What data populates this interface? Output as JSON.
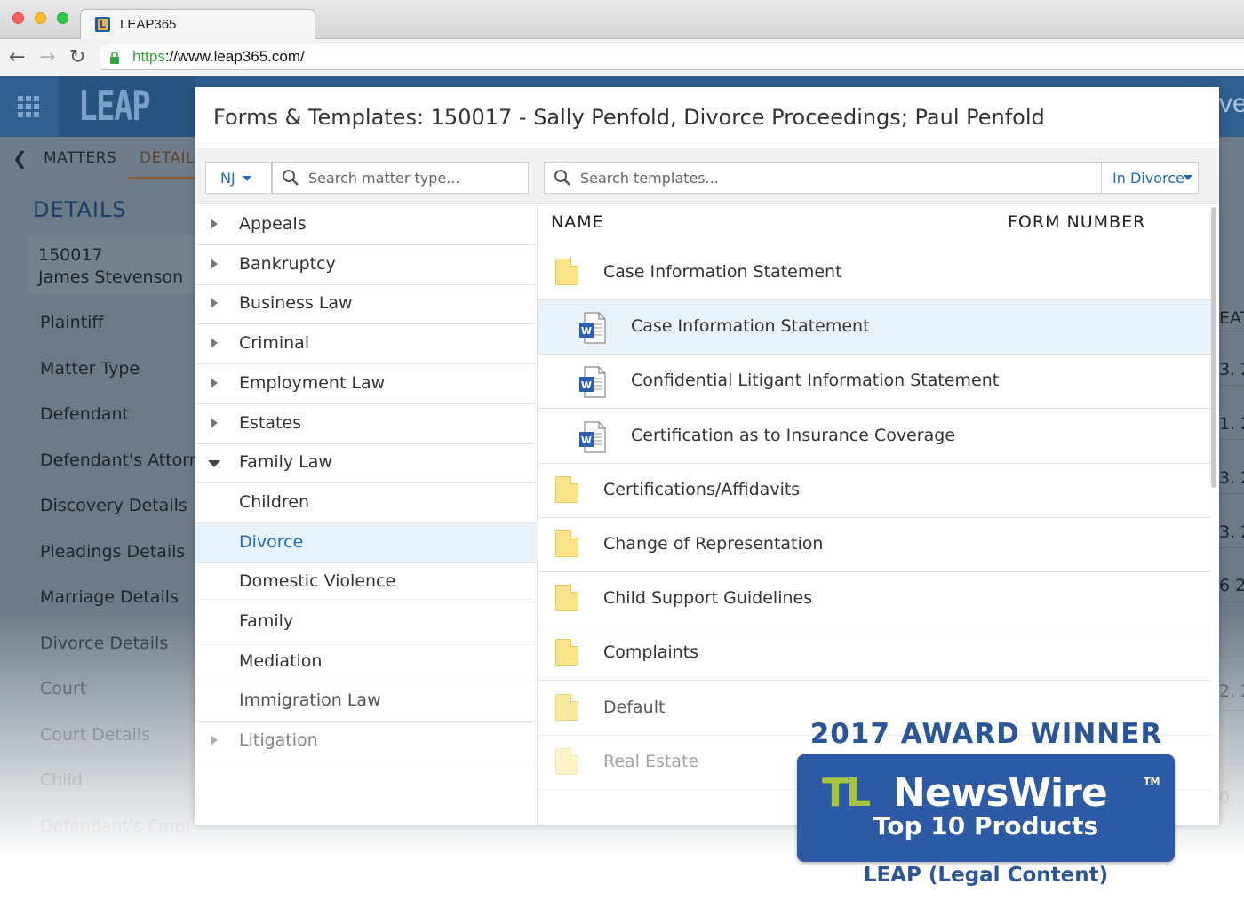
{
  "browser": {
    "tab_title": "LEAP365",
    "favicon_letter": "L",
    "url_scheme": "https",
    "url_rest": "://www.leap365.com/",
    "back_icon": "back-arrow-icon",
    "forward_icon": "forward-arrow-icon",
    "reload_icon": "reload-icon",
    "lock_icon": "lock-icon"
  },
  "app": {
    "logo": "LEAP",
    "header_right_fragment": "ve",
    "subnav": {
      "matters": "MATTERS",
      "details": "DETAIL"
    },
    "sidebar": {
      "title": "DETAILS",
      "matter_id": "150017",
      "matter_name": "James Stevenson",
      "items": [
        "Plaintiff",
        "Matter Type",
        "Defendant",
        "Defendant's Attorn",
        "Discovery Details",
        "Pleadings Details",
        "Marriage Details",
        "Divorce Details",
        "Court",
        "Court Details",
        "Child",
        "Defendant's Empl"
      ]
    },
    "right_strip": {
      "header_fragment": "EAT",
      "values": [
        "3. 2",
        "1. 2",
        "3. 2",
        "3. 2",
        "6 2",
        "2. 2",
        "0."
      ]
    }
  },
  "modal": {
    "title": "Forms & Templates: 150017 - Sally Penfold, Divorce Proceedings; Paul Penfold",
    "state_value": "NJ",
    "matter_search_placeholder": "Search matter type...",
    "template_search_placeholder": "Search templates...",
    "template_scope_value": "In Divorce",
    "tree": [
      {
        "label": "Appeals",
        "state": "collapsed",
        "level": 0
      },
      {
        "label": "Bankruptcy",
        "state": "collapsed",
        "level": 0
      },
      {
        "label": "Business Law",
        "state": "collapsed",
        "level": 0
      },
      {
        "label": "Criminal",
        "state": "collapsed",
        "level": 0
      },
      {
        "label": "Employment Law",
        "state": "collapsed",
        "level": 0
      },
      {
        "label": "Estates",
        "state": "collapsed",
        "level": 0
      },
      {
        "label": "Family Law",
        "state": "expanded",
        "level": 0
      },
      {
        "label": "Children",
        "state": "leaf",
        "level": 1
      },
      {
        "label": "Divorce",
        "state": "leaf",
        "level": 1,
        "selected": true
      },
      {
        "label": "Domestic Violence",
        "state": "leaf",
        "level": 1
      },
      {
        "label": "Family",
        "state": "leaf",
        "level": 1
      },
      {
        "label": "Mediation",
        "state": "leaf",
        "level": 1
      },
      {
        "label": "Immigration Law",
        "state": "leaf",
        "level": 0
      },
      {
        "label": "Litigation",
        "state": "collapsed",
        "level": 0
      }
    ],
    "columns": {
      "name": "NAME",
      "form_number": "FORM NUMBER"
    },
    "templates": [
      {
        "label": "Case Information Statement",
        "kind": "folder"
      },
      {
        "label": "Case Information Statement",
        "kind": "word",
        "selected": true
      },
      {
        "label": "Confidential Litigant Information Statement",
        "kind": "word"
      },
      {
        "label": "Certification as to Insurance Coverage",
        "kind": "word"
      },
      {
        "label": "Certifications/Affidavits",
        "kind": "folder"
      },
      {
        "label": "Change of Representation",
        "kind": "folder"
      },
      {
        "label": "Child Support Guidelines",
        "kind": "folder"
      },
      {
        "label": "Complaints",
        "kind": "folder"
      },
      {
        "label": "Default",
        "kind": "folder"
      },
      {
        "label": "Real Estate",
        "kind": "folder"
      }
    ]
  },
  "award": {
    "headline": "2017 AWARD WINNER",
    "tl": "TL",
    "newswire": "NewsWire",
    "tm": "TM",
    "top10": "Top 10 Products",
    "product": "LEAP (Legal Content)"
  },
  "colors": {
    "accent": "#1e6bb8",
    "header": "#2e5f8e",
    "selection": "#e8f2fb",
    "award_blue": "#2d5aa4",
    "award_green": "#a7c43c"
  }
}
